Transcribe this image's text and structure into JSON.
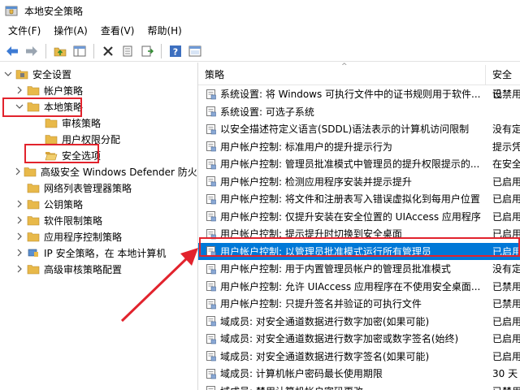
{
  "window": {
    "title": "本地安全策略"
  },
  "menu": {
    "items": [
      "文件(F)",
      "操作(A)",
      "查看(V)",
      "帮助(H)"
    ]
  },
  "toolbar": {
    "buttons": [
      "back-icon",
      "forward-icon",
      "up-folder-icon",
      "show-hide-tree-icon",
      "delete-icon",
      "properties-icon",
      "export-icon",
      "help-icon",
      "console-icon"
    ]
  },
  "tree": {
    "items": [
      {
        "label": "安全设置",
        "level": 0,
        "expanded": true,
        "icon": "shield-folder-icon"
      },
      {
        "label": "帐户策略",
        "level": 1,
        "expanded": false,
        "icon": "folder-icon"
      },
      {
        "label": "本地策略",
        "level": 1,
        "expanded": true,
        "icon": "folder-icon"
      },
      {
        "label": "审核策略",
        "level": 2,
        "expanded": false,
        "icon": "folder-icon"
      },
      {
        "label": "用户权限分配",
        "level": 2,
        "expanded": false,
        "icon": "folder-icon"
      },
      {
        "label": "安全选项",
        "level": 2,
        "expanded": false,
        "icon": "folder-open-icon"
      },
      {
        "label": "高级安全 Windows Defender 防火墙",
        "level": 1,
        "expanded": false,
        "icon": "firewall-folder-icon"
      },
      {
        "label": "网络列表管理器策略",
        "level": 1,
        "expanded": false,
        "icon": "folder-icon"
      },
      {
        "label": "公钥策略",
        "level": 1,
        "expanded": false,
        "icon": "folder-icon"
      },
      {
        "label": "软件限制策略",
        "level": 1,
        "expanded": false,
        "icon": "folder-icon"
      },
      {
        "label": "应用程序控制策略",
        "level": 1,
        "expanded": false,
        "icon": "folder-icon"
      },
      {
        "label": "IP 安全策略，在 本地计算机",
        "level": 1,
        "expanded": false,
        "icon": "ipsec-icon"
      },
      {
        "label": "高级审核策略配置",
        "level": 1,
        "expanded": false,
        "icon": "folder-icon"
      }
    ]
  },
  "list": {
    "columns": [
      "策略",
      "安全设"
    ],
    "rows": [
      {
        "policy": "系统设置: 将 Windows 可执行文件中的证书规则用于软件...",
        "setting": "已禁用"
      },
      {
        "policy": "系统设置: 可选子系统",
        "setting": ""
      },
      {
        "policy": "以安全描述符定义语言(SDDL)语法表示的计算机访问限制",
        "setting": "没有定"
      },
      {
        "policy": "用户帐户控制: 标准用户的提升提示行为",
        "setting": "提示凭"
      },
      {
        "policy": "用户帐户控制: 管理员批准模式中管理员的提升权限提示的...",
        "setting": "在安全"
      },
      {
        "policy": "用户帐户控制: 检测应用程序安装并提示提升",
        "setting": "已启用"
      },
      {
        "policy": "用户帐户控制: 将文件和注册表写入错误虚拟化到每用户位置",
        "setting": "已启用"
      },
      {
        "policy": "用户帐户控制: 仅提升安装在安全位置的 UIAccess 应用程序",
        "setting": "已启用"
      },
      {
        "policy": "用户帐户控制: 提示提升时切换到安全桌面",
        "setting": "已启用"
      },
      {
        "policy": "用户帐户控制: 以管理员批准模式运行所有管理员",
        "setting": "已启用",
        "selected": true
      },
      {
        "policy": "用户帐户控制: 用于内置管理员帐户的管理员批准模式",
        "setting": "没有定"
      },
      {
        "policy": "用户帐户控制: 允许 UIAccess 应用程序在不使用安全桌面...",
        "setting": "已禁用"
      },
      {
        "policy": "用户帐户控制: 只提升签名并验证的可执行文件",
        "setting": "已禁用"
      },
      {
        "policy": "域成员: 对安全通道数据进行数字加密(如果可能)",
        "setting": "已启用"
      },
      {
        "policy": "域成员: 对安全通道数据进行数字加密或数字签名(始终)",
        "setting": "已启用"
      },
      {
        "policy": "域成员: 对安全通道数据进行数字签名(如果可能)",
        "setting": "已启用"
      },
      {
        "policy": "域成员: 计算机帐户密码最长使用期限",
        "setting": "30 天"
      },
      {
        "policy": "域成员: 禁用计算机帐户密码更改",
        "setting": "已禁用"
      }
    ]
  },
  "colors": {
    "selection": "#0078d7",
    "annotation": "#e2232d",
    "folder": "#e8b94a"
  }
}
